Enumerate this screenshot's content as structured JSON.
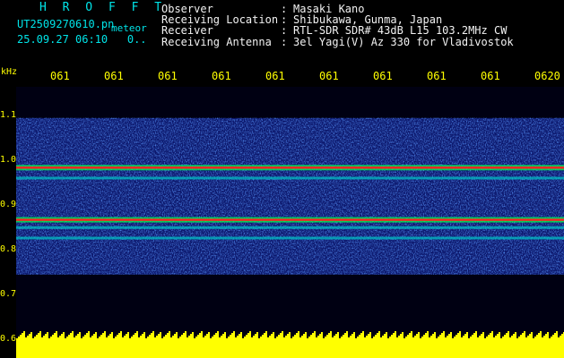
{
  "header": {
    "app_name": "H R O F F T",
    "filename": "UT2509270610.pn",
    "process_label": "meteor",
    "datetime": "25.09.27 06:10",
    "frame_indicator": "0..",
    "info_rows": [
      {
        "label": "Observer",
        "value": "Masaki Kano"
      },
      {
        "label": "Receiving Location",
        "value": "Shibukawa, Gunma, Japan"
      },
      {
        "label": "Receiver",
        "value": "RTL-SDR SDR# 43dB L15 103.2MHz CW"
      },
      {
        "label": "Receiving Antenna",
        "value": "3el Yagi(V) Az 330 for Vladivostok"
      }
    ],
    "separator": ":"
  },
  "axis": {
    "unit_label": "kHz",
    "time_ticks": [
      "061",
      "061",
      "061",
      "061",
      "061",
      "061",
      "061",
      "061",
      "061",
      "0620"
    ],
    "freq_labels": [
      "1.1",
      "1.0",
      "0.9",
      "0.8",
      "0.7",
      "0.6"
    ]
  },
  "spectrogram": {
    "freq_range_khz": [
      0.58,
      1.1
    ],
    "band_khz": [
      0.74,
      1.04
    ],
    "signal_lines_khz": [
      0.945,
      0.845
    ],
    "secondary_lines_khz": [
      0.925,
      0.83,
      0.81
    ],
    "colors": {
      "background": "#000012",
      "noise": "#1428b4",
      "mid": "#00c8c8",
      "green": "#00ff50",
      "signal": "#ff2020",
      "axis": "#ffff00",
      "cyan_text": "#00e4e8"
    }
  }
}
